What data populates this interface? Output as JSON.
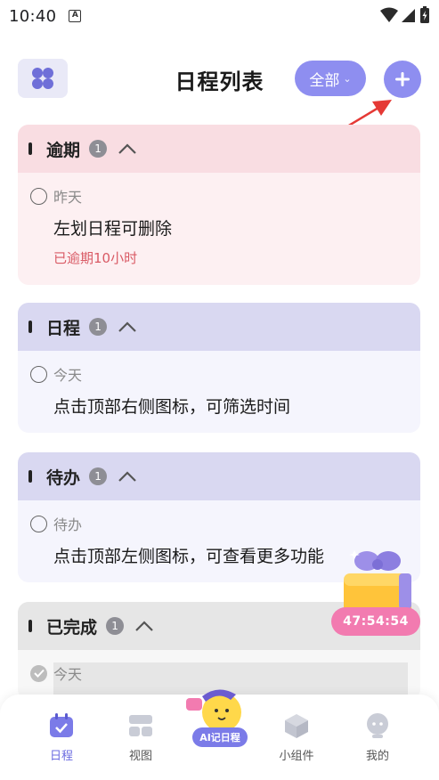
{
  "status_bar": {
    "time": "10:40",
    "notification": "A"
  },
  "header": {
    "title": "日程列表",
    "filter_label": "全部"
  },
  "sections": [
    {
      "title": "逾期",
      "count": "1",
      "item": {
        "date": "昨天",
        "title": "左划日程可删除",
        "note": "已逾期10小时"
      }
    },
    {
      "title": "日程",
      "count": "1",
      "item": {
        "date": "今天",
        "title": "点击顶部右侧图标，可筛选时间"
      }
    },
    {
      "title": "待办",
      "count": "1",
      "item": {
        "date": "待办",
        "title": "点击顶部左侧图标，可查看更多功能"
      }
    },
    {
      "title": "已完成",
      "count": "1",
      "item": {
        "date": "今天"
      }
    }
  ],
  "floating": {
    "timer": "47:54:54"
  },
  "bottom_nav": {
    "items": [
      {
        "label": "日程",
        "icon": "calendar-icon",
        "active": true
      },
      {
        "label": "视图",
        "icon": "grid-view-icon"
      },
      {
        "label": "小组件",
        "icon": "cube-icon"
      },
      {
        "label": "我的",
        "icon": "profile-icon"
      }
    ],
    "ai_label": "AI记日程"
  },
  "colors": {
    "accent": "#8e8ef0",
    "overdue_bg": "#fdf0f2",
    "overdue_head": "#f9dde2",
    "overdue_text": "#d95a65",
    "schedule_head": "#d9d8f1",
    "done_head": "#e6e6e6",
    "timer_pill": "#f27bb0",
    "arrow": "#e53935"
  }
}
